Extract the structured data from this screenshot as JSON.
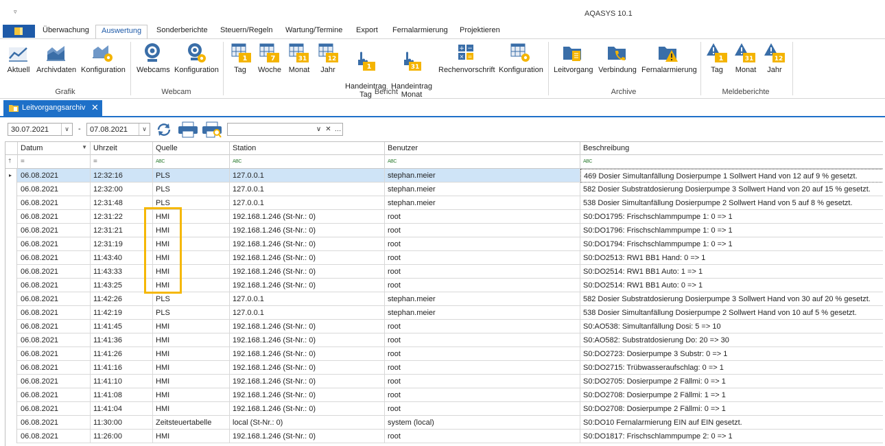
{
  "app": {
    "quick_access": "▿",
    "title": "AQASYS 10.1"
  },
  "tabs": [
    {
      "label": "Überwachung"
    },
    {
      "label": "Auswertung"
    },
    {
      "label": "Sonderberichte"
    },
    {
      "label": "Steuern/Regeln"
    },
    {
      "label": "Wartung/Termine"
    },
    {
      "label": "Export"
    },
    {
      "label": "Fernalarmierung"
    },
    {
      "label": "Projektieren"
    }
  ],
  "ribbon": {
    "groups": [
      {
        "label": "Grafik"
      },
      {
        "label": "Webcam"
      },
      {
        "label": "Bericht"
      },
      {
        "label": "Archive"
      },
      {
        "label": "Meldeberichte"
      }
    ],
    "buttons": [
      {
        "label": "Aktuell",
        "icon": "line-chart-icon"
      },
      {
        "label": "Archivdaten",
        "icon": "area-chart-icon"
      },
      {
        "label": "Konfiguration",
        "icon": "chart-gear-icon"
      },
      {
        "label": "Webcams",
        "icon": "webcam-icon"
      },
      {
        "label": "Konfiguration",
        "icon": "webcam-gear-icon"
      },
      {
        "label": "Tag",
        "icon": "report-day-icon",
        "badge": "1"
      },
      {
        "label": "Woche",
        "icon": "report-week-icon",
        "badge": "7"
      },
      {
        "label": "Monat",
        "icon": "report-month-icon",
        "badge": "31"
      },
      {
        "label": "Jahr",
        "icon": "report-year-icon",
        "badge": "12"
      },
      {
        "label": "Handeintrag\nTag",
        "icon": "hand-entry-day-icon",
        "badge": "1"
      },
      {
        "label": "Handeintrag\nMonat",
        "icon": "hand-entry-month-icon",
        "badge": "31"
      },
      {
        "label": "Rechenvorschrift",
        "icon": "calculator-icon"
      },
      {
        "label": "Konfiguration",
        "icon": "report-gear-icon"
      },
      {
        "label": "Leitvorgang",
        "icon": "folder-doc-icon"
      },
      {
        "label": "Verbindung",
        "icon": "folder-phone-icon"
      },
      {
        "label": "Fernalarmierung",
        "icon": "folder-warning-icon"
      },
      {
        "label": "Tag",
        "icon": "alarm-day-icon",
        "badge": "1"
      },
      {
        "label": "Monat",
        "icon": "alarm-month-icon",
        "badge": "31"
      },
      {
        "label": "Jahr",
        "icon": "alarm-year-icon",
        "badge": "12"
      }
    ]
  },
  "document_tab": {
    "label": "Leitvorgangsarchiv",
    "close": "✕"
  },
  "toolbar": {
    "date_from": "30.07.2021",
    "date_sep": "-",
    "date_to": "07.08.2021",
    "filter_value": "",
    "dropdown_glyph": "∨",
    "clear_glyph": "✕",
    "more_glyph": "…"
  },
  "grid": {
    "columns": [
      "Datum",
      "Uhrzeit",
      "Quelle",
      "Station",
      "Benutzer",
      "Beschreibung"
    ],
    "filter_row": {
      "pin": "†",
      "equals": "=",
      "text": "ABC"
    },
    "current_row_marker": "▸",
    "rows": [
      {
        "datum": "06.08.2021",
        "uhrzeit": "12:32:16",
        "quelle": "PLS",
        "station": "127.0.0.1",
        "benutzer": "stephan.meier",
        "beschreibung": "469 Dosier Simultanfällung Dosierpumpe 1 Sollwert Hand von 12 auf 9 % gesetzt."
      },
      {
        "datum": "06.08.2021",
        "uhrzeit": "12:32:00",
        "quelle": "PLS",
        "station": "127.0.0.1",
        "benutzer": "stephan.meier",
        "beschreibung": "582 Dosier Substratdosierung Dosierpumpe 3 Sollwert Hand von 20 auf 15 % gesetzt."
      },
      {
        "datum": "06.08.2021",
        "uhrzeit": "12:31:48",
        "quelle": "PLS",
        "station": "127.0.0.1",
        "benutzer": "stephan.meier",
        "beschreibung": "538 Dosier Simultanfällung Dosierpumpe 2 Sollwert Hand von 5 auf 8 % gesetzt."
      },
      {
        "datum": "06.08.2021",
        "uhrzeit": "12:31:22",
        "quelle": "HMI",
        "station": "192.168.1.246 (St-Nr.: 0)",
        "benutzer": "root",
        "beschreibung": "S0:DO1795: Frischschlammpumpe 1: 0 => 1"
      },
      {
        "datum": "06.08.2021",
        "uhrzeit": "12:31:21",
        "quelle": "HMI",
        "station": "192.168.1.246 (St-Nr.: 0)",
        "benutzer": "root",
        "beschreibung": "S0:DO1796: Frischschlammpumpe 1: 0 => 1"
      },
      {
        "datum": "06.08.2021",
        "uhrzeit": "12:31:19",
        "quelle": "HMI",
        "station": "192.168.1.246 (St-Nr.: 0)",
        "benutzer": "root",
        "beschreibung": "S0:DO1794: Frischschlammpumpe 1: 0 => 1"
      },
      {
        "datum": "06.08.2021",
        "uhrzeit": "11:43:40",
        "quelle": "HMI",
        "station": "192.168.1.246 (St-Nr.: 0)",
        "benutzer": "root",
        "beschreibung": "S0:DO2513: RW1 BB1 Hand: 0 => 1"
      },
      {
        "datum": "06.08.2021",
        "uhrzeit": "11:43:33",
        "quelle": "HMI",
        "station": "192.168.1.246 (St-Nr.: 0)",
        "benutzer": "root",
        "beschreibung": "S0:DO2514: RW1 BB1 Auto: 1 => 1"
      },
      {
        "datum": "06.08.2021",
        "uhrzeit": "11:43:25",
        "quelle": "HMI",
        "station": "192.168.1.246 (St-Nr.: 0)",
        "benutzer": "root",
        "beschreibung": "S0:DO2514: RW1 BB1 Auto: 0 => 1"
      },
      {
        "datum": "06.08.2021",
        "uhrzeit": "11:42:26",
        "quelle": "PLS",
        "station": "127.0.0.1",
        "benutzer": "stephan.meier",
        "beschreibung": "582 Dosier Substratdosierung Dosierpumpe 3 Sollwert Hand von 30 auf 20 % gesetzt."
      },
      {
        "datum": "06.08.2021",
        "uhrzeit": "11:42:19",
        "quelle": "PLS",
        "station": "127.0.0.1",
        "benutzer": "stephan.meier",
        "beschreibung": "538 Dosier Simultanfällung Dosierpumpe 2 Sollwert Hand von 10 auf 5 % gesetzt."
      },
      {
        "datum": "06.08.2021",
        "uhrzeit": "11:41:45",
        "quelle": "HMI",
        "station": "192.168.1.246 (St-Nr.: 0)",
        "benutzer": "root",
        "beschreibung": "S0:AO538: Simultanfällung Dosi: 5 => 10"
      },
      {
        "datum": "06.08.2021",
        "uhrzeit": "11:41:36",
        "quelle": "HMI",
        "station": "192.168.1.246 (St-Nr.: 0)",
        "benutzer": "root",
        "beschreibung": "S0:AO582: Substratdosierung Do: 20 => 30"
      },
      {
        "datum": "06.08.2021",
        "uhrzeit": "11:41:26",
        "quelle": "HMI",
        "station": "192.168.1.246 (St-Nr.: 0)",
        "benutzer": "root",
        "beschreibung": "S0:DO2723: Dosierpumpe 3 Substr: 0 => 1"
      },
      {
        "datum": "06.08.2021",
        "uhrzeit": "11:41:16",
        "quelle": "HMI",
        "station": "192.168.1.246 (St-Nr.: 0)",
        "benutzer": "root",
        "beschreibung": "S0:DO2715: Trübwasseraufschlag: 0 => 1"
      },
      {
        "datum": "06.08.2021",
        "uhrzeit": "11:41:10",
        "quelle": "HMI",
        "station": "192.168.1.246 (St-Nr.: 0)",
        "benutzer": "root",
        "beschreibung": "S0:DO2705: Dosierpumpe 2 Fällmi: 0 => 1"
      },
      {
        "datum": "06.08.2021",
        "uhrzeit": "11:41:08",
        "quelle": "HMI",
        "station": "192.168.1.246 (St-Nr.: 0)",
        "benutzer": "root",
        "beschreibung": "S0:DO2708: Dosierpumpe 2 Fällmi: 1 => 1"
      },
      {
        "datum": "06.08.2021",
        "uhrzeit": "11:41:04",
        "quelle": "HMI",
        "station": "192.168.1.246 (St-Nr.: 0)",
        "benutzer": "root",
        "beschreibung": "S0:DO2708: Dosierpumpe 2 Fällmi: 0 => 1"
      },
      {
        "datum": "06.08.2021",
        "uhrzeit": "11:30:00",
        "quelle": "Zeitsteuertabelle",
        "station": "local (St-Nr.: 0)",
        "benutzer": "system (local)",
        "beschreibung": "S0:DO10 Fernalarmierung EIN auf EIN gesetzt."
      },
      {
        "datum": "06.08.2021",
        "uhrzeit": "11:26:00",
        "quelle": "HMI",
        "station": "192.168.1.246 (St-Nr.: 0)",
        "benutzer": "root",
        "beschreibung": "S0:DO1817: Frischschlammpumpe 2: 0 => 1"
      }
    ]
  },
  "colors": {
    "accent": "#1e70c8",
    "file_button": "#1e5aa8",
    "selected_row": "#cfe4f7",
    "highlight_box": "#f5b700",
    "icon_blue": "#3a6ea8",
    "icon_yellow": "#f4b400"
  }
}
